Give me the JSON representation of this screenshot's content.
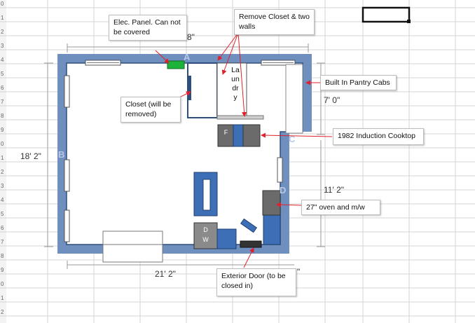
{
  "sheet": {
    "row_labels": [
      "0",
      "1",
      "2",
      "3",
      "4",
      "5",
      "6",
      "7",
      "8",
      "9",
      "0",
      "1",
      "2",
      "3",
      "4",
      "5",
      "6",
      "7",
      "8",
      "9",
      "0",
      "1",
      "2"
    ]
  },
  "plan": {
    "dimensions": {
      "top": "23' 8\"",
      "left": "18' 2\"",
      "right_upper": "7' 0\"",
      "right_lower": "11' 2\"",
      "bottom": "21' 2\"",
      "bottom_partial": "\""
    },
    "wall_letters": {
      "a": "A",
      "b": "B",
      "c": "C",
      "d": "D"
    },
    "appliance_labels": {
      "fridge": "F",
      "dishwasher": "D\nW"
    },
    "laundry_label": "La\nun\ndr\ny"
  },
  "callouts": {
    "elec_panel": "Elec. Panel. Can not be covered",
    "remove_closet": "Remove Closet & two walls",
    "pantry": "Built In Pantry Cabs",
    "closet": "Closet (will be removed)",
    "cooktop": "1982 Induction Cooktop",
    "oven": "27\" oven and m/w",
    "exterior_door": "Exterior Door (to be closed in)"
  },
  "colors": {
    "wall": "#6f8fbf",
    "wall_line": "#2e4f7d",
    "cabinet": "#3d6fb6",
    "appliance": "#6b6b6b",
    "panel": "#1db33b",
    "arrow": "#e0202a",
    "grid": "#d6d6d6"
  }
}
